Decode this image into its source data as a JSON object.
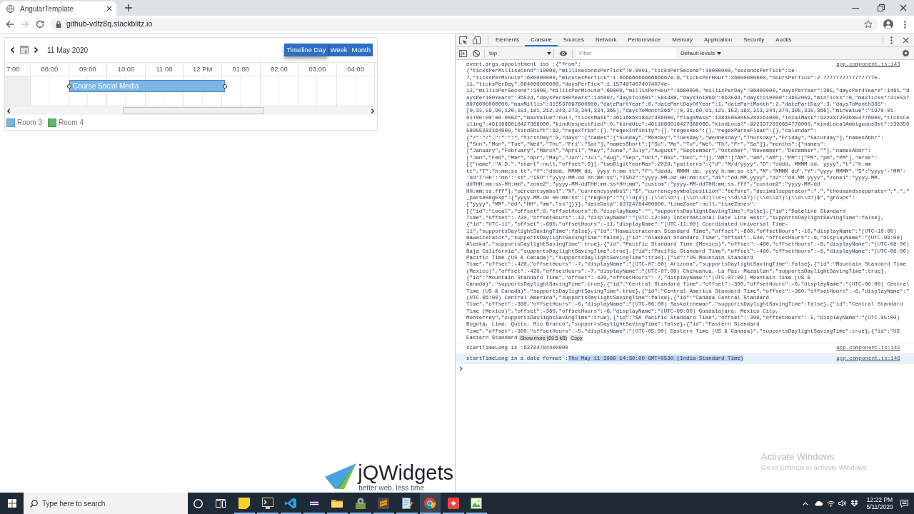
{
  "browser": {
    "tab": {
      "title": "AngularTemplate"
    },
    "nav": [
      {
        "kind": "back",
        "disabled": false
      },
      {
        "kind": "forward",
        "disabled": true
      },
      {
        "kind": "reload",
        "disabled": false
      }
    ],
    "address": "github-vdfz8q.stackblitz.io"
  },
  "scheduler": {
    "date": "11 May 2020",
    "views": [
      {
        "label": "Timeline Day",
        "selected": true
      },
      {
        "label": "Week",
        "selected": false
      },
      {
        "label": "Month",
        "selected": false
      }
    ],
    "hours": [
      "7:00",
      "08:00",
      "09:00",
      "10:00",
      "11:00",
      "12 PM",
      "01:00",
      "02:00",
      "03:00",
      "04:00"
    ],
    "appointments": [
      {
        "subject": "Course Social Media",
        "color": "#7ab6e6"
      }
    ],
    "legend": [
      {
        "label": "Room 3",
        "color": "#7ab6e6"
      },
      {
        "label": "Room 4",
        "color": "#5fb86a"
      }
    ]
  },
  "logo": {
    "name": "jQWidgets",
    "tagline": "better web, less time"
  },
  "devtools": {
    "tabs": [
      {
        "label": "Elements",
        "selected": false
      },
      {
        "label": "Console",
        "selected": true
      },
      {
        "label": "Sources",
        "selected": false
      },
      {
        "label": "Network",
        "selected": false
      },
      {
        "label": "Performance",
        "selected": false
      },
      {
        "label": "Memory",
        "selected": false
      },
      {
        "label": "Application",
        "selected": false
      },
      {
        "label": "Security",
        "selected": false
      },
      {
        "label": "Audits",
        "selected": false
      }
    ],
    "context": "top",
    "filter": {
      "placeholder": "Filter"
    },
    "levels": "Default levels",
    "messages": [
      {
        "text": "event.args.appointment iss :{\"from\":",
        "text_continued": "{\"ticksPerMillisecond\":10000,\"millisecondsPerTick\":0.0001,\"ticksPerSecond\":10000000,\"secondsPerTick\":1e-7,\"ticksPerMinute\":600000000,\"minutesPerTick\":1.6666666666666667e-9,\"ticksPerHour\":36000000000,\"hoursPerTick\":2.7777777777777777e-11,\"ticksPerDay\":864000000000,\"daysPerTick\":1.1574074074074074e-12,\"millisPerSecond\":1000,\"millisPerMinute\":60000,\"millisPerHour\":3600000,\"millisPerDay\":86400000,\"daysPerYear\":365,\"daysPer4Years\":1461,\"daysPer100Years\":36524,\"daysPer400Years\":146097,\"daysTo1601\":584388,\"daysTo1899\":693593,\"daysTo10000\":3652059,\"minTicks\":0,\"maxTicks\":3155378976000000000,\"maxMillis\":315537897600000,\"datePartYear\":0,\"datePartDayOfYear\":1,\"datePartMonth\":2,\"datePartDay\":3,\"daysToMonth365\":[0,31,59,90,120,151,181,212,243,273,304,334,365],\"daysToMonth366\":[0,31,60,91,121,152,182,213,244,274,305,335,366],\"minValue\":\"1970-01-01T00:00:00.000Z\",\"maxValue\":null,\"ticksMask\":4611686018427388000,\"flagsMask\":13835058055282164000,\"localMask\":9223372036854776000,\"ticksCeiling\":4611686018427388000,\"kindUnspecified\":0,\"kindUtc\":4611686018427388000,\"kindLocal\":9223372036854776000,\"kindLocalAmbiguousDst\":13835058055282164000,\"kindShift\":62,\"regexTrim\":{},\"regexInfinity\":{},\"regexHex\":{},\"regexParseFloat\":{},\"calendar\":{\"/\":\"/\",\":\":\":\",\"firstDay\":0,\"days\":{\"names\":[\"Sunday\",\"Monday\",\"Tuesday\",\"Wednesday\",\"Thursday\",\"Friday\",\"Saturday\"],\"namesAbbr\":[\"Sun\",\"Mon\",\"Tue\",\"Wed\",\"Thu\",\"Fri\",\"Sat\"],\"namesShort\":[\"Su\",\"Mo\",\"Tu\",\"We\",\"Th\",\"Fr\",\"Sa\"]},\"months\":{\"names\":[\"January\",\"February\",\"March\",\"April\",\"May\",\"June\",\"July\",\"August\",\"September\",\"October\",\"November\",\"December\",\"\"],\"namesAbbr\":[\"Jan\",\"Feb\",\"Mar\",\"Apr\",\"May\",\"Jun\",\"Jul\",\"Aug\",\"Sep\",\"Oct\",\"Nov\",\"Dec\",\"\"]},\"AM\":[\"AM\",\"am\",\"AM\"],\"PM\":[\"PM\",\"pm\",\"PM\"],\"eras\":[{\"name\":\"A.D.\",\"start\":null,\"offset\":0}],\"twoDigitYearMax\":2029,\"patterns\":{\"d\":\"M/d/yyyy\",\"D\":\"dddd, MMMM dd, yyyy\",\"t\":\"h:mm tt\",\"T\":\"h:mm:ss tt\",\"f\":\"dddd, MMMM dd, yyyy h:mm tt\",\"F\":\"dddd, MMMM dd, yyyy h:mm:ss tt\",\"M\":\"MMMM dd\",\"Y\":\"yyyy MMMM\",\"S\":\"yyyy'-'MM'-'dd'T'HH':'mm':'ss\",\"ISO\":\"yyyy-MM-dd hh:mm:ss\",\"ISO2\":\"yyyy-MM-dd HH:mm:ss\",\"d1\":\"dd.MM.yyyy\",\"d2\":\"dd-MM-yyyy\",\"zone1\":\"yyyy-MM-ddTHH:mm:ss-HH:mm\",\"zone2\":\"yyyy-MM-ddTHH:mm:ss+HH:mm\",\"custom\":\"yyyy-MM-ddTHH:mm:ss.fff\",\"custom2\":\"yyyy-MM-dd HH:mm:ss.fff\"},\"percentsymbol\":\"%\",\"currencysymbol\":\"$\",\"currencysymbolposition\":\"before\",\"decimalseparator\":\".\",\"thousandsseparator\":\",\",\"_parseRegExp\":{\"yyyy-MM-dd HH:mm:ss\":{\"regExp\":\"^(\\\\d{4})-(\\\\d\\\\d?)-(\\\\d\\\\d?)\\\\s+(\\\\d\\\\d?):(\\\\d\\\\d?):(\\\\d\\\\d?)$\",\"groups\":[\"yyyy\",\"MM\",\"dd\",\"HH\",\"mm\",\"ss\"]}}},\"dateData\":63724784400000,\"timeZone\":null,\"timeZones\":[{\"id\":\"Local\",\"offset\":0,\"offsetHours\":0,\"displayName\":\"\",\"supportsDaylightSavingTime\":false},{\"id\":\"Dateline Standard Time\",\"offset\":-720,\"offsetHours\":-12,\"displayName\":\"(UTC-12:00) International Date Line West\",\"supportsDaylightSavingTime\":false},{\"id\":\"UTC-11\",\"offset\":-660,\"offsetHours\":-11,\"displayName\":\"(UTC-11:00) Coordinated Universal Time-11\",\"supportsDaylightSavingTime\":false},{\"id\":\"Hawaiteratoran Standard Time\",\"offset\":-600,\"offsetHours\":-10,\"displayName\":\"(UTC-10:00) Hawaiterator\",\"supportsDaylightSavingTime\":false},{\"id\":\"Alaskan Standard Time\",\"offset\":-540,\"offsetHours\":-9,\"displayName\":\"(UTC-09:00) Alaska\",\"supportsDaylightSavingTime\":true},{\"id\":\"Pacific Standard Time (Mexico)\",\"offset\":-480,\"offsetHours\":-8,\"displayName\":\"(UTC-08:00) Baja California\",\"supportsDaylightSavingTime\":true},{\"id\":\"Pacific Standard Time\",\"offset\":-480,\"offsetHours\":-8,\"displayName\":\"(UTC-08:00) Pacific Time (US & Canada)\",\"supportsDaylightSavingTime\":true},{\"id\":\"US Mountain Standard Time\",\"offset\":-420,\"offsetHours\":-7,\"displayName\":\"(UTC-07:00) Arizona\",\"supportsDaylightSavingTime\":false},{\"id\":\"Mountain Standard Time (Mexico)\",\"offset\":-420,\"offsetHours\":-7,\"displayName\":\"(UTC-07:00) Chihuahua, La Paz, Mazatlan\",\"supportsDaylightSavingTime\":true},{\"id\":\"Mountain Standard Time\",\"offset\":-420,\"offsetHours\":-7,\"displayName\":\"(UTC-07:00) Mountain Time (US & Canada)\",\"supportsDaylightSavingTime\":true},{\"id\":\"Central Standard Time\",\"offset\":-360,\"offsetHours\":-6,\"displayName\":\"(UTC-06:00) Central Time (US & Canada)\",\"supportsDaylightSavingTime\":true},{\"id\":\"Central America Standard Time\",\"offset\":-360,\"offsetHours\":-6,\"displayName\":\"(UTC-06:00) Central America\",\"supportsDaylightSavingTime\":false},{\"id\":\"Canada Central Standard Time\",\"offset\":-360,\"offsetHours\":-6,\"displayName\":\"(UTC-06:00) Saskatchewan\",\"supportsDaylightSavingTime\":false},{\"id\":\"Central Standard Time (Mexico)\",\"offset\":-360,\"offsetHours\":-6,\"displayName\":\"(UTC-06:00) Guadalajara, Mexico City, Monterrey\",\"supportsDaylightSavingTime\":true},{\"id\":\"SA Pacific Standard Time\",\"offset\":-300,\"offsetHours\":-5,\"displayName\":\"(UTC-05:00) Bogota, Lima, Quito, Rio Branco\",\"supportsDaylightSavingTime\":false},{\"id\":\"Eastern Standard Time\",\"offset\":-300,\"offsetHours\":-5,\"displayName\":\"(UTC-05:00) Eastern Time (US & Canada)\",\"supportsDaylightSavingTime\":true},{\"id\":\"US",
        "text_end": "Eastern Standard",
        "source": "app.component.ts:143",
        "actions": [
          "Show more (69.5 kB)",
          "Copy"
        ],
        "hovered": false
      },
      {
        "text": "startTimeLong is :63724784400000",
        "source": "app.component.ts:145",
        "hovered": false
      },
      {
        "text": "startTimeLong in a date format :",
        "selected_text": "Thu May 11 3989 14:30:00 GMT+0530 (India Standard Time)",
        "source": "app.component.ts:146",
        "hovered": true
      }
    ]
  },
  "os_notice": {
    "title": "Activate Windows",
    "text": "Go to Settings to activate Windows."
  },
  "taskbar": {
    "search": {
      "placeholder": "Type here to search"
    },
    "apps": [
      {
        "kind": "notes",
        "running": true,
        "active": false
      },
      {
        "kind": "terminal",
        "running": true,
        "active": false
      },
      {
        "kind": "code",
        "running": true,
        "active": false
      },
      {
        "kind": "orb",
        "running": true,
        "active": false
      },
      {
        "kind": "folder",
        "running": true,
        "active": false
      },
      {
        "kind": "gearbox",
        "running": true,
        "active": false
      },
      {
        "kind": "editor",
        "running": true,
        "active": false
      },
      {
        "kind": "notepad",
        "running": true,
        "active": false
      },
      {
        "kind": "browser",
        "running": true,
        "active": true
      },
      {
        "kind": "remote",
        "running": true,
        "active": false
      },
      {
        "kind": "picture",
        "running": true,
        "active": false
      }
    ],
    "clock": {
      "time": "12:22 PM",
      "date": "5/11/2020"
    }
  }
}
